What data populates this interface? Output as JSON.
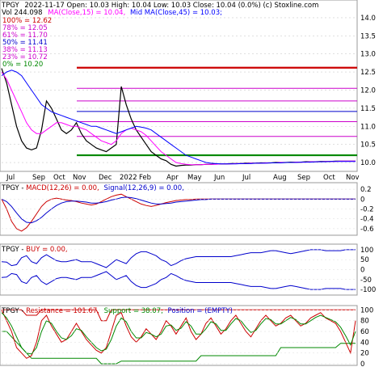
{
  "header": {
    "symbol": "TPGY",
    "line1_rest": "2022-11-17 Open: 10.03  High: 10.04  Low: 10.03  Close: 10.04 (0.0%)  (c) Stoxline.com",
    "line2": "Vol 244.098",
    "ma15_label": "MA(Close,15) = 10.04,",
    "ma45_label": "Mid MA(Close,45) = 10.03;"
  },
  "fib_levels": [
    {
      "label": "100% = 12.62",
      "value": 12.62,
      "color": "#cc0000"
    },
    {
      "label": "78% = 12.05",
      "value": 12.05,
      "color": "#cc00cc"
    },
    {
      "label": "61% = 11.70",
      "value": 11.7,
      "color": "#cc00cc"
    },
    {
      "label": "50% = 11.41",
      "value": 11.41,
      "color": "#0000cc"
    },
    {
      "label": "38% = 11.13",
      "value": 11.13,
      "color": "#cc00cc"
    },
    {
      "label": "23% = 10.72",
      "value": 10.72,
      "color": "#cc00cc"
    },
    {
      "label": "0% = 10.20",
      "value": 10.2,
      "color": "#008800"
    }
  ],
  "x_labels": [
    "Jul",
    "Sep",
    "Oct",
    "Nov",
    "Dec",
    "2022",
    "Feb",
    "Apr",
    "May",
    "Jun",
    "Jul",
    "Aug",
    "Sep",
    "Oct",
    "Nov"
  ],
  "panels": {
    "macd": {
      "label_prefix": "TPGY - ",
      "label_macd": "MACD(12,26) = 0.00,",
      "label_signal": "Signal(12,26,9) = 0.00,",
      "ticks": [
        "0.2",
        "0",
        "-0.2",
        "-0.4",
        "-0.6"
      ]
    },
    "buy": {
      "label_prefix": "TPGY - ",
      "label_buy": "BUY = 0.00,",
      "ticks": [
        "100",
        "50",
        "0",
        "-50",
        "-100"
      ]
    },
    "stoch": {
      "label_prefix": "TPGY - ",
      "label_res": "Resistance = 101.67,",
      "label_sup": "Support = 38.07,",
      "label_pos": "Position = (EMPTY)",
      "ticks": [
        "100",
        "80",
        "60",
        "40",
        "20",
        "0"
      ]
    }
  },
  "colors": {
    "up": "#008800",
    "down": "#cc0000",
    "ma_fast": "#ff00ff",
    "ma_mid": "#0000ff",
    "price": "#000000"
  },
  "chart_data": [
    {
      "type": "line",
      "name": "price",
      "ylim": [
        9.8,
        14.4
      ],
      "yticks": [
        10.0,
        10.5,
        11.0,
        11.5,
        12.0,
        12.5,
        13.0,
        13.5,
        14.0
      ],
      "series": [
        {
          "name": "Close",
          "values": [
            12.6,
            12.2,
            11.6,
            11.0,
            10.6,
            10.4,
            10.35,
            10.4,
            10.9,
            11.7,
            11.5,
            11.2,
            10.9,
            10.8,
            10.9,
            11.1,
            10.8,
            10.6,
            10.5,
            10.4,
            10.35,
            10.3,
            10.4,
            10.5,
            12.1,
            11.6,
            11.2,
            10.9,
            10.7,
            10.5,
            10.3,
            10.2,
            10.1,
            10.05,
            9.95,
            9.9,
            9.92,
            9.93,
            9.93,
            9.94,
            9.94,
            9.95,
            9.95,
            9.96,
            9.96,
            9.96,
            9.97,
            9.97,
            9.97,
            9.98,
            9.98,
            9.98,
            9.99,
            9.99,
            9.99,
            10.0,
            10.0,
            10.0,
            10.01,
            10.01,
            10.01,
            10.02,
            10.02,
            10.02,
            10.03,
            10.03,
            10.03,
            10.04,
            10.04,
            10.04,
            10.04,
            10.04
          ]
        },
        {
          "name": "MA(Close,15)",
          "values": [
            12.5,
            12.3,
            12.0,
            11.7,
            11.4,
            11.1,
            10.9,
            10.8,
            10.8,
            10.9,
            11.0,
            11.1,
            11.1,
            11.05,
            11.0,
            11.0,
            10.95,
            10.9,
            10.8,
            10.7,
            10.6,
            10.55,
            10.5,
            10.6,
            10.8,
            10.9,
            10.95,
            10.9,
            10.85,
            10.75,
            10.6,
            10.45,
            10.3,
            10.2,
            10.1,
            10.0,
            9.97,
            9.95,
            9.94,
            9.94,
            9.94,
            9.95,
            9.95,
            9.95,
            9.96,
            9.96,
            9.96,
            9.97,
            9.97,
            9.97,
            9.98,
            9.98,
            9.98,
            9.99,
            9.99,
            9.99,
            10.0,
            10.0,
            10.0,
            10.01,
            10.01,
            10.01,
            10.02,
            10.02,
            10.02,
            10.03,
            10.03,
            10.03,
            10.04,
            10.04,
            10.04,
            10.04
          ]
        },
        {
          "name": "Mid MA(Close,45)",
          "values": [
            12.4,
            12.5,
            12.55,
            12.5,
            12.4,
            12.2,
            12.0,
            11.8,
            11.6,
            11.5,
            11.4,
            11.35,
            11.3,
            11.25,
            11.2,
            11.15,
            11.1,
            11.05,
            11.0,
            11.0,
            10.95,
            10.9,
            10.85,
            10.8,
            10.85,
            10.9,
            10.95,
            11.0,
            10.98,
            10.95,
            10.9,
            10.8,
            10.7,
            10.6,
            10.5,
            10.4,
            10.3,
            10.2,
            10.15,
            10.1,
            10.05,
            10.0,
            9.98,
            9.97,
            9.96,
            9.96,
            9.96,
            9.96,
            9.97,
            9.97,
            9.97,
            9.98,
            9.98,
            9.98,
            9.99,
            9.99,
            9.99,
            10.0,
            10.0,
            10.0,
            10.01,
            10.01,
            10.01,
            10.02,
            10.02,
            10.02,
            10.03,
            10.03,
            10.03,
            10.03,
            10.03,
            10.03
          ]
        }
      ]
    },
    {
      "type": "line",
      "name": "macd",
      "ylim": [
        -0.7,
        0.3
      ],
      "series": [
        {
          "name": "MACD(12,26)",
          "values": [
            0.0,
            -0.2,
            -0.45,
            -0.6,
            -0.65,
            -0.58,
            -0.45,
            -0.3,
            -0.15,
            -0.05,
            0.0,
            0.02,
            0.0,
            -0.02,
            -0.03,
            -0.05,
            -0.08,
            -0.1,
            -0.12,
            -0.1,
            -0.05,
            0.0,
            0.05,
            0.08,
            0.1,
            0.05,
            0.0,
            -0.05,
            -0.1,
            -0.13,
            -0.15,
            -0.13,
            -0.1,
            -0.07,
            -0.05,
            -0.03,
            -0.02,
            -0.01,
            -0.01,
            0.0,
            0.0,
            0.0,
            0.0,
            0.0,
            0.0,
            0.0,
            0.0,
            0.0,
            0.0,
            0.0,
            0.0,
            0.0,
            0.0,
            0.0,
            0.0,
            0.0,
            0.0,
            0.0,
            0.0,
            0.0,
            0.0,
            0.0,
            0.0,
            0.0,
            0.0,
            0.0,
            0.0,
            0.0,
            0.0,
            0.0,
            0.0,
            0.0
          ]
        },
        {
          "name": "Signal(12,26,9)",
          "values": [
            0.0,
            -0.05,
            -0.15,
            -0.28,
            -0.4,
            -0.47,
            -0.48,
            -0.44,
            -0.37,
            -0.28,
            -0.2,
            -0.13,
            -0.08,
            -0.05,
            -0.04,
            -0.04,
            -0.05,
            -0.06,
            -0.08,
            -0.08,
            -0.07,
            -0.05,
            -0.02,
            0.0,
            0.03,
            0.04,
            0.03,
            0.01,
            -0.02,
            -0.05,
            -0.08,
            -0.1,
            -0.1,
            -0.09,
            -0.08,
            -0.06,
            -0.05,
            -0.04,
            -0.03,
            -0.02,
            -0.01,
            -0.01,
            0.0,
            0.0,
            0.0,
            0.0,
            0.0,
            0.0,
            0.0,
            0.0,
            0.0,
            0.0,
            0.0,
            0.0,
            0.0,
            0.0,
            0.0,
            0.0,
            0.0,
            0.0,
            0.0,
            0.0,
            0.0,
            0.0,
            0.0,
            0.0,
            0.0,
            0.0,
            0.0,
            0.0,
            0.0,
            0.0
          ]
        }
      ]
    },
    {
      "type": "line",
      "name": "buy",
      "ylim": [
        -120,
        120
      ],
      "series": [
        {
          "name": "upper",
          "values": [
            40,
            38,
            20,
            25,
            60,
            70,
            40,
            30,
            60,
            75,
            60,
            45,
            40,
            40,
            45,
            50,
            40,
            40,
            40,
            30,
            20,
            10,
            30,
            50,
            40,
            30,
            60,
            80,
            90,
            90,
            80,
            70,
            50,
            40,
            20,
            30,
            45,
            55,
            60,
            65,
            65,
            65,
            65,
            65,
            65,
            65,
            65,
            70,
            75,
            80,
            85,
            85,
            85,
            90,
            95,
            95,
            90,
            85,
            80,
            85,
            90,
            95,
            100,
            100,
            100,
            95,
            95,
            95,
            95,
            100,
            100,
            100
          ]
        },
        {
          "name": "lower",
          "values": [
            -40,
            -38,
            -20,
            -25,
            -60,
            -70,
            -40,
            -30,
            -60,
            -75,
            -60,
            -45,
            -40,
            -40,
            -45,
            -50,
            -40,
            -40,
            -40,
            -30,
            -20,
            -10,
            -30,
            -50,
            -40,
            -30,
            -60,
            -80,
            -90,
            -90,
            -80,
            -70,
            -50,
            -40,
            -20,
            -30,
            -45,
            -55,
            -60,
            -65,
            -65,
            -65,
            -65,
            -65,
            -65,
            -65,
            -65,
            -70,
            -75,
            -80,
            -85,
            -85,
            -85,
            -90,
            -95,
            -95,
            -90,
            -85,
            -80,
            -85,
            -90,
            -95,
            -100,
            -100,
            -100,
            -95,
            -95,
            -95,
            -95,
            -100,
            -100,
            -100
          ]
        }
      ]
    },
    {
      "type": "line",
      "name": "stochastic",
      "ylim": [
        0,
        105
      ],
      "series": [
        {
          "name": "Resistance",
          "values": [
            100,
            100,
            100,
            100,
            100,
            90,
            90,
            90,
            100,
            100,
            100,
            100,
            100,
            100,
            100,
            100,
            100,
            100,
            100,
            100,
            80,
            80,
            100,
            100,
            100,
            100,
            100,
            100,
            100,
            100,
            100,
            100,
            100,
            100,
            100,
            100,
            100,
            100,
            100,
            100,
            100,
            100,
            100,
            100,
            100,
            100,
            100,
            100,
            100,
            100,
            100,
            100,
            100,
            100,
            100,
            100,
            100,
            100,
            100,
            100,
            100,
            100,
            100,
            100,
            100,
            100,
            100,
            100,
            100,
            100,
            100,
            100
          ]
        },
        {
          "name": "Support",
          "values": [
            60,
            60,
            50,
            40,
            30,
            20,
            10,
            10,
            10,
            10,
            10,
            10,
            10,
            10,
            10,
            10,
            10,
            10,
            10,
            10,
            0,
            0,
            0,
            0,
            5,
            5,
            5,
            5,
            5,
            5,
            5,
            5,
            5,
            5,
            5,
            5,
            5,
            5,
            5,
            5,
            15,
            15,
            15,
            15,
            15,
            15,
            15,
            15,
            15,
            15,
            15,
            15,
            15,
            15,
            15,
            15,
            30,
            30,
            30,
            30,
            30,
            30,
            30,
            30,
            30,
            30,
            30,
            30,
            38,
            38,
            38,
            38
          ]
        },
        {
          "name": "Fast",
          "values": [
            100,
            80,
            60,
            30,
            20,
            10,
            15,
            40,
            80,
            90,
            70,
            55,
            40,
            45,
            60,
            75,
            60,
            45,
            35,
            25,
            20,
            30,
            60,
            90,
            95,
            70,
            50,
            40,
            50,
            65,
            55,
            45,
            60,
            80,
            70,
            55,
            70,
            85,
            60,
            45,
            55,
            75,
            85,
            70,
            55,
            65,
            80,
            90,
            75,
            60,
            50,
            65,
            80,
            90,
            80,
            70,
            75,
            85,
            90,
            80,
            70,
            75,
            85,
            90,
            95,
            85,
            80,
            75,
            60,
            40,
            20,
            80
          ]
        },
        {
          "name": "Slow",
          "values": [
            95,
            85,
            70,
            50,
            30,
            20,
            18,
            30,
            60,
            80,
            75,
            60,
            48,
            45,
            52,
            65,
            62,
            50,
            40,
            30,
            24,
            27,
            45,
            70,
            85,
            78,
            60,
            48,
            48,
            58,
            55,
            50,
            55,
            70,
            72,
            62,
            66,
            78,
            70,
            55,
            55,
            65,
            78,
            74,
            62,
            62,
            74,
            84,
            80,
            68,
            58,
            62,
            74,
            84,
            82,
            74,
            74,
            80,
            86,
            82,
            74,
            74,
            80,
            86,
            90,
            86,
            82,
            78,
            68,
            52,
            35,
            60
          ]
        }
      ]
    }
  ]
}
